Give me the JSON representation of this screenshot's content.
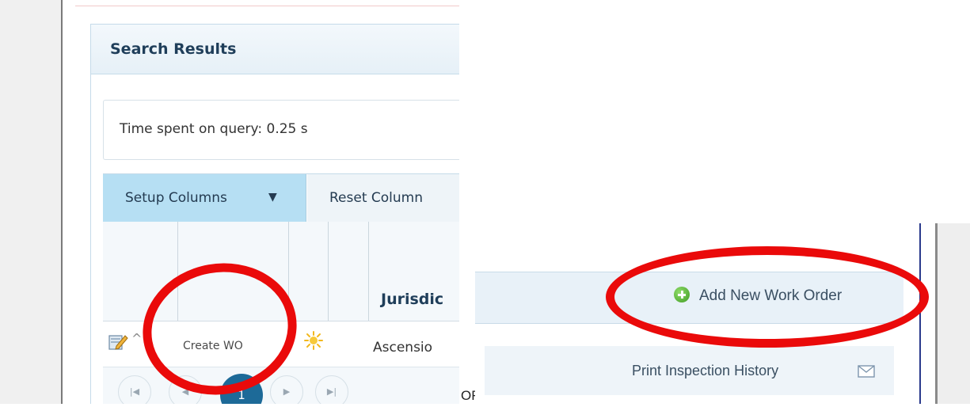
{
  "left_screenshot": {
    "panel_title": "Search Results",
    "query_time_text": "Time spent on query: 0.25 s",
    "toolbar": {
      "setup_columns_label": "Setup Columns",
      "setup_columns_caret": "▼",
      "reset_columns_label": "Reset Column"
    },
    "grid": {
      "jurisdiction_header": "Jurisdic",
      "row": {
        "caret": "^",
        "create_wo_label": "Create WO",
        "jurisdiction_value": "Ascensio"
      }
    },
    "pager": {
      "first": "|◀",
      "prev": "◀",
      "current_page": "1",
      "next": "▶",
      "last": "▶|"
    }
  },
  "separator_label": "OR",
  "right_screenshot": {
    "add_new_work_order_label": "Add New Work Order",
    "print_inspection_history_label": "Print Inspection History"
  },
  "icons": {
    "edit": "edit-icon",
    "sun": "sun-icon",
    "add": "add-circle-icon",
    "mail": "mail-icon"
  },
  "colors": {
    "highlight": "#ea0a0a",
    "toolbar_active": "#b6dff3",
    "page_current": "#1d6a98",
    "add_icon": "#3f9b22"
  }
}
